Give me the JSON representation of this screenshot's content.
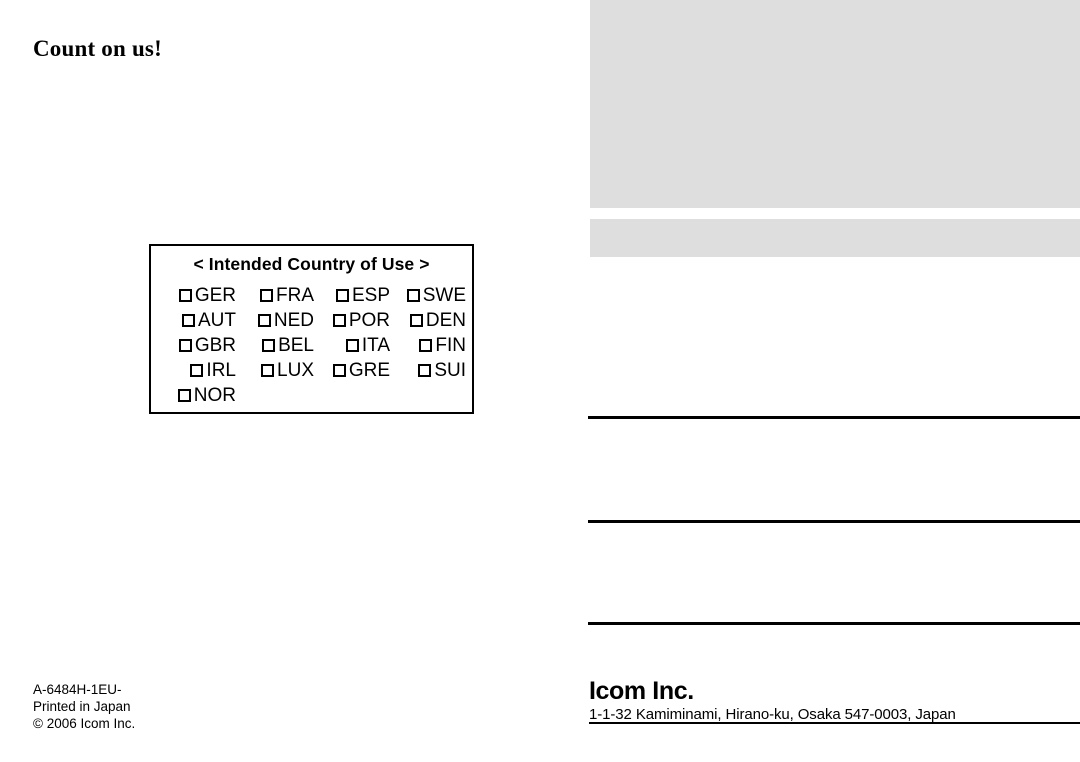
{
  "page": {
    "tagline": "Count on us!",
    "background_color": "#ffffff",
    "panel_gray": "#dedede",
    "rule_color": "#000000"
  },
  "country_box": {
    "title": "< Intended Country of Use >",
    "checkbox_glyph": "empty-checkbox",
    "rows": [
      [
        "GER",
        "FRA",
        "ESP",
        "SWE"
      ],
      [
        "AUT",
        "NED",
        "POR",
        "DEN"
      ],
      [
        "GBR",
        "BEL",
        "ITA",
        "FIN"
      ],
      [
        "IRL",
        "LUX",
        "GRE",
        "SUI"
      ],
      [
        "NOR",
        "",
        "",
        ""
      ]
    ],
    "countries": [
      "GER",
      "FRA",
      "ESP",
      "SWE",
      "AUT",
      "NED",
      "POR",
      "DEN",
      "GBR",
      "BEL",
      "ITA",
      "FIN",
      "IRL",
      "LUX",
      "GRE",
      "SUI",
      "NOR"
    ]
  },
  "imprint": {
    "line1": "A-6484H-1EU-",
    "line2": "Printed in Japan",
    "line3": "© 2006 Icom Inc."
  },
  "footer": {
    "company": "Icom Inc.",
    "address": "1-1-32 Kamiminami, Hirano-ku, Osaka 547-0003, Japan"
  }
}
